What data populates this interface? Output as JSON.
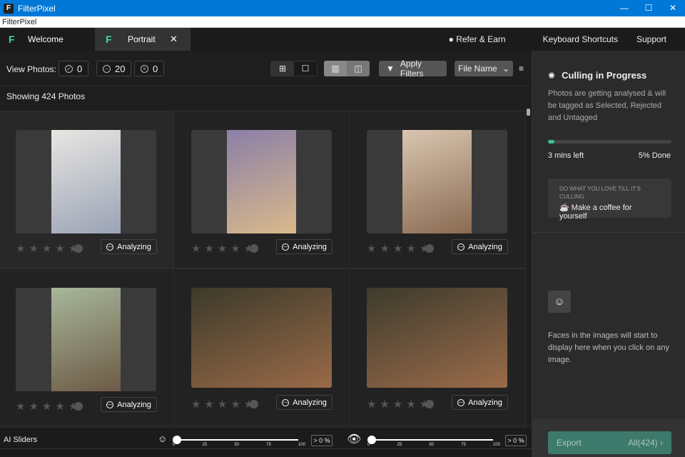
{
  "window": {
    "title": "FilterPixel",
    "menu": "FilterPixel",
    "logo_text": "F"
  },
  "tabs": [
    {
      "label": "Welcome"
    },
    {
      "label": "Portrait",
      "close": "✕"
    }
  ],
  "top_links": [
    "Refer & Earn",
    "Keyboard Shortcuts",
    "Support"
  ],
  "toolbar": {
    "view_label": "View Photos:",
    "counts": {
      "selected": "0",
      "untagged": "20",
      "rejected": "0"
    },
    "apply_filters": "Apply Filters",
    "sort": "File Name"
  },
  "showing": "Showing 424 Photos",
  "photos": [
    {
      "status": "Analyzing",
      "colors": [
        "#e8e6e2",
        "#9aa3b5"
      ],
      "orient": "portrait"
    },
    {
      "status": "Analyzing",
      "colors": [
        "#8b7fa8",
        "#d9b98a"
      ],
      "orient": "portrait"
    },
    {
      "status": "Analyzing",
      "colors": [
        "#d9c6b0",
        "#8a6a52"
      ],
      "orient": "portrait"
    },
    {
      "status": "Analyzing",
      "colors": [
        "#a7b79a",
        "#6d5a46"
      ],
      "orient": "portrait"
    },
    {
      "status": "Analyzing",
      "colors": [
        "#3c3a2a",
        "#9a6a48"
      ],
      "orient": "landscape"
    },
    {
      "status": "Analyzing",
      "colors": [
        "#3d3b2c",
        "#9b6b4a"
      ],
      "orient": "landscape"
    }
  ],
  "panel": {
    "title": "Culling in Progress",
    "desc": "Photos are getting analysed & will be tagged as Selected, Rejected and Untagged",
    "progress": 5,
    "time_left": "3 mins left",
    "done": "5% Done",
    "tip_heading": "DO WHAT YOU LOVE TILL IT'S CULLING",
    "tip": "Make a coffee for yourself",
    "faces_text": "Faces in the images will start to display here when you click on any image.",
    "export": "Export",
    "export_count": "All(424)"
  },
  "sliders": {
    "label": "AI Sliders",
    "ticks": [
      "0",
      "25",
      "50",
      "75",
      "100"
    ],
    "face_value": "> 0 %",
    "eye_value": "> 0 %"
  },
  "colors": {
    "accent": "#3fd6b5",
    "export_bg": "#3e7a6c",
    "titlebar": "#0078d7"
  }
}
